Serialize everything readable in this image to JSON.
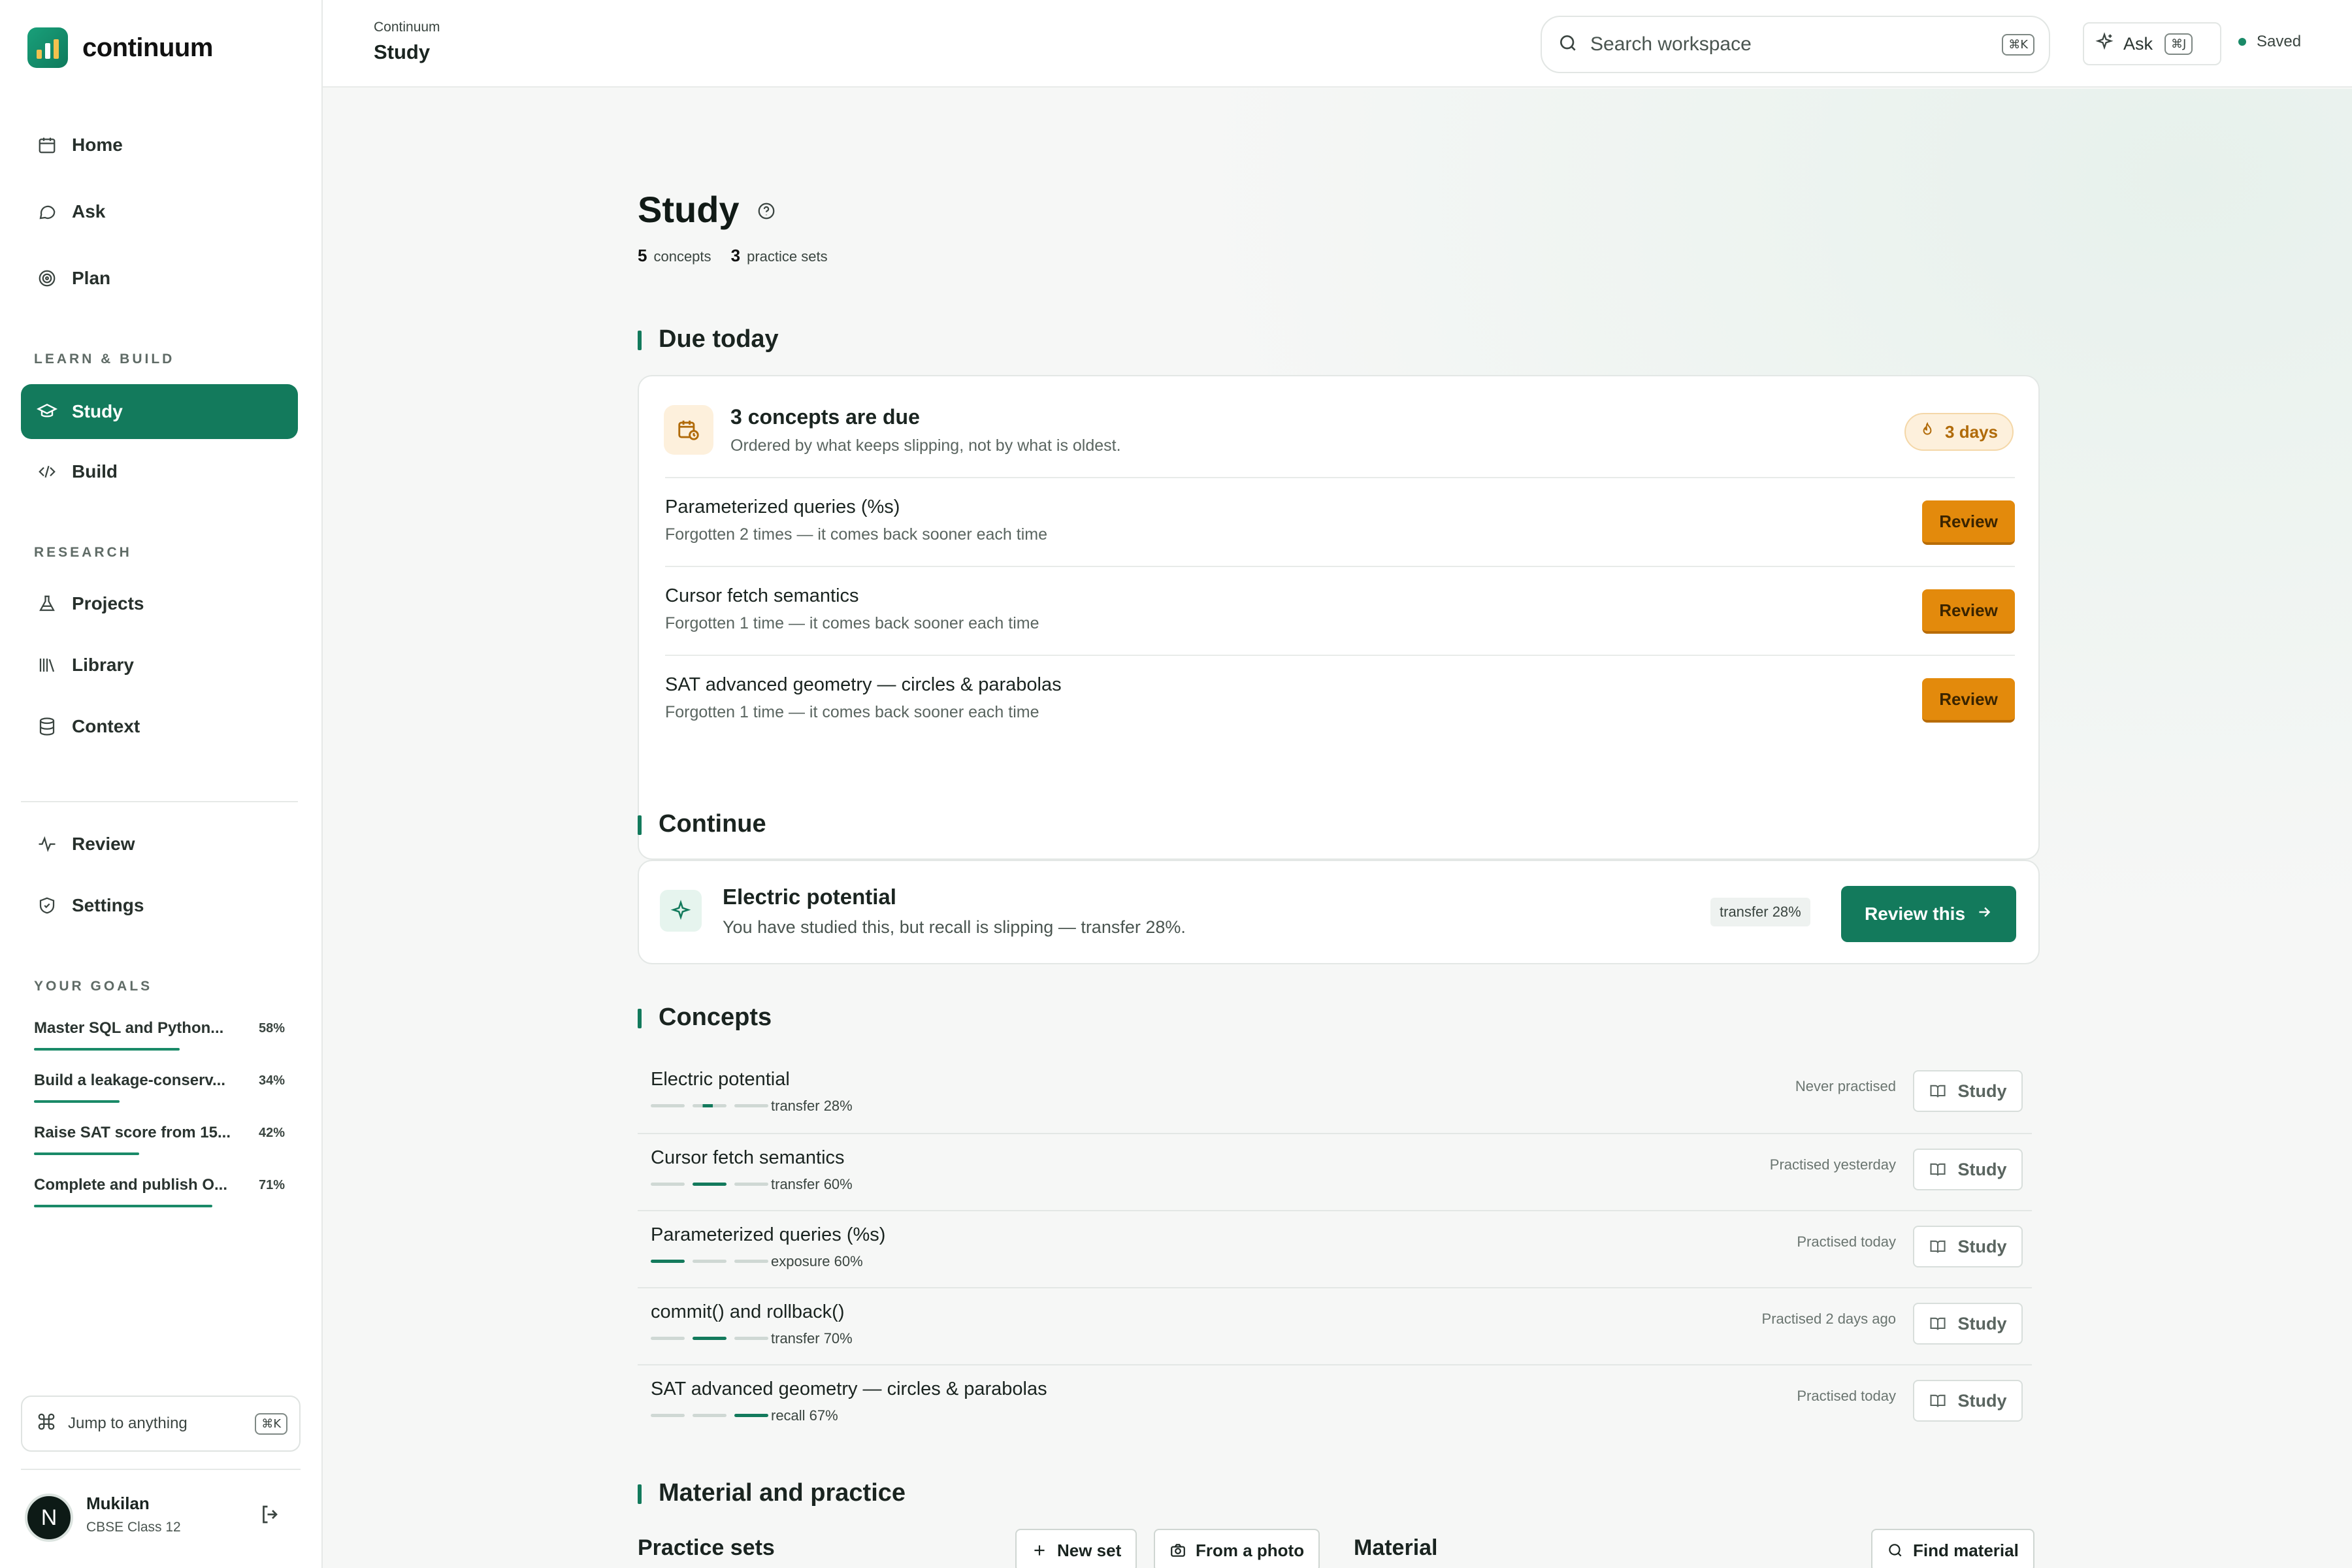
{
  "brand": {
    "name": "continuum"
  },
  "sidebar": {
    "main_items": [
      {
        "label": "Home",
        "icon": "calendar-icon"
      },
      {
        "label": "Ask",
        "icon": "chat-icon"
      },
      {
        "label": "Plan",
        "icon": "target-icon"
      }
    ],
    "learn_build_label": "LEARN & BUILD",
    "learn_build_items": [
      {
        "label": "Study",
        "icon": "graduation-cap-icon",
        "active": true
      },
      {
        "label": "Build",
        "icon": "code-icon"
      }
    ],
    "research_label": "RESEARCH",
    "research_items": [
      {
        "label": "Projects",
        "icon": "flask-icon"
      },
      {
        "label": "Library",
        "icon": "library-icon"
      },
      {
        "label": "Context",
        "icon": "database-icon"
      }
    ],
    "bottom_items": [
      {
        "label": "Review",
        "icon": "pulse-icon"
      },
      {
        "label": "Settings",
        "icon": "shield-icon"
      }
    ],
    "goals_label": "YOUR GOALS",
    "goals": [
      {
        "name": "Master SQL and Python...",
        "pct": "58%",
        "progress": 0.58
      },
      {
        "name": "Build a leakage-conserv...",
        "pct": "34%",
        "progress": 0.34
      },
      {
        "name": "Raise SAT score from 15...",
        "pct": "42%",
        "progress": 0.42
      },
      {
        "name": "Complete and publish O...",
        "pct": "71%",
        "progress": 0.71
      }
    ],
    "jump": {
      "label": "Jump to anything",
      "shortcut": "⌘K"
    },
    "profile": {
      "initial": "N",
      "name": "Mukilan",
      "class": "CBSE Class 12"
    }
  },
  "topbar": {
    "breadcrumb": "Continuum",
    "title": "Study",
    "search_placeholder": "Search workspace",
    "search_shortcut": "⌘K",
    "ask_label": "Ask",
    "ask_shortcut": "⌘J",
    "saved_label": "Saved"
  },
  "page": {
    "title": "Study",
    "concepts_count": "5",
    "concepts_label": "concepts",
    "sets_count": "3",
    "sets_label": "practice sets"
  },
  "due": {
    "heading": "Due today",
    "title": "3 concepts are due",
    "subtitle": "Ordered by what keeps slipping, not by what is oldest.",
    "streak": "3 days",
    "items": [
      {
        "name": "Parameterized queries (%s)",
        "desc": "Forgotten 2 times — it comes back sooner each time",
        "action": "Review"
      },
      {
        "name": "Cursor fetch semantics",
        "desc": "Forgotten 1 time — it comes back sooner each time",
        "action": "Review"
      },
      {
        "name": "SAT advanced geometry — circles & parabolas",
        "desc": "Forgotten 1 time — it comes back sooner each time",
        "action": "Review"
      }
    ]
  },
  "continue": {
    "heading": "Continue",
    "title": "Electric potential",
    "subtitle": "You have studied this, but recall is slipping — transfer 28%.",
    "chip": "transfer 28%",
    "action": "Review this"
  },
  "concepts": {
    "heading": "Concepts",
    "items": [
      {
        "name": "Electric potential",
        "metric": "transfer 28%",
        "practised": "Never practised",
        "action": "Study",
        "level": 2
      },
      {
        "name": "Cursor fetch semantics",
        "metric": "transfer 60%",
        "practised": "Practised yesterday",
        "action": "Study",
        "level": 2
      },
      {
        "name": "Parameterized queries (%s)",
        "metric": "exposure 60%",
        "practised": "Practised today",
        "action": "Study",
        "level": 1
      },
      {
        "name": "commit() and rollback()",
        "metric": "transfer 70%",
        "practised": "Practised 2 days ago",
        "action": "Study",
        "level": 2
      },
      {
        "name": "SAT advanced geometry — circles & parabolas",
        "metric": "recall 67%",
        "practised": "Practised today",
        "action": "Study",
        "level": 3
      }
    ]
  },
  "material_practice": {
    "heading": "Material and practice",
    "practice_sets_label": "Practice sets",
    "new_set_label": "New set",
    "from_photo_label": "From a photo",
    "material_label": "Material",
    "find_material_label": "Find material"
  },
  "colors": {
    "accent": "#137a5c",
    "review": "#e38a0c",
    "streak_bg": "#fdf0dc"
  }
}
